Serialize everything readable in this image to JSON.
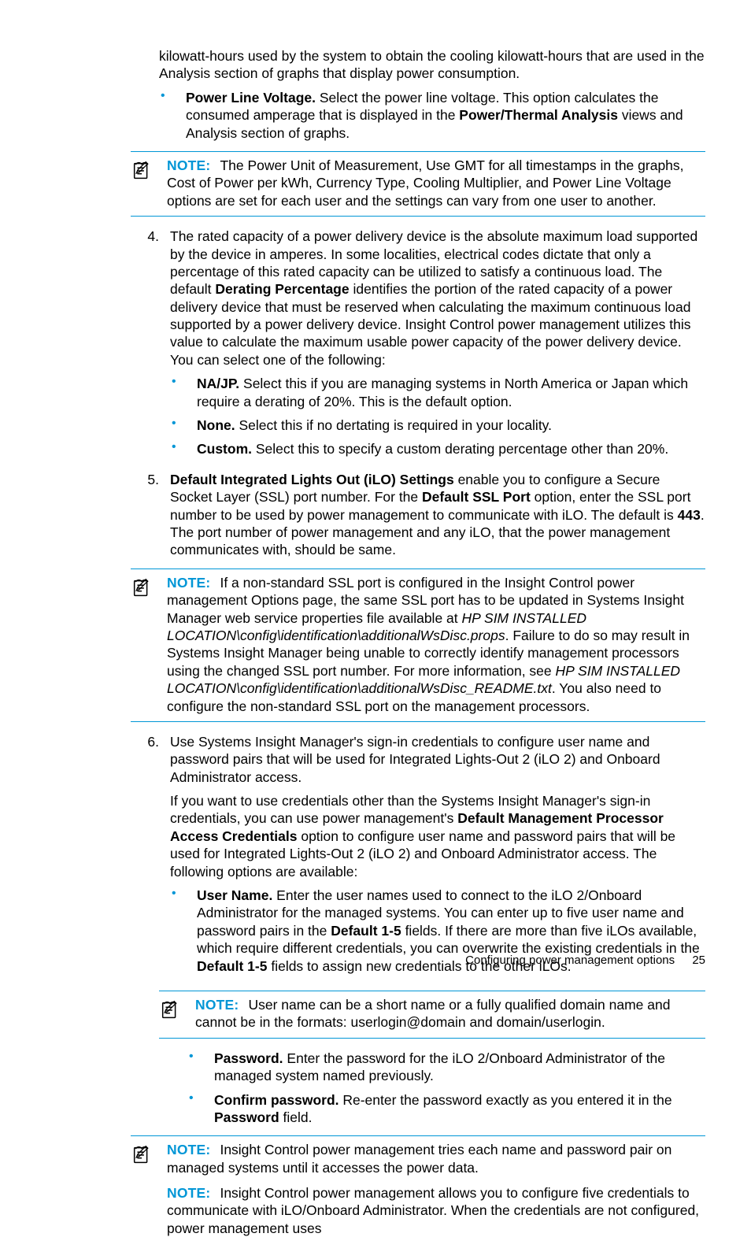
{
  "intro": {
    "p1": "kilowatt-hours used by the system to obtain the cooling kilowatt-hours that are used in the Analysis section of graphs that display power consumption."
  },
  "pvolt": {
    "label": "Power Line Voltage.",
    "text_a": " Select the power line voltage. This option calculates the consumed amperage that is displayed in the ",
    "b1": "Power/Thermal Analysis",
    "text_b": " views and Analysis section of graphs."
  },
  "note1": {
    "label": "NOTE:",
    "text": "The Power Unit of Measurement, Use GMT for all timestamps in the graphs, Cost of Power per kWh, Currency Type, Cooling Multiplier, and Power Line Voltage options are set for each user and the settings can vary from one user to another."
  },
  "item4": {
    "num": "4.",
    "text_a": "The rated capacity of a power delivery device is the absolute maximum load supported by the device in amperes. In some localities, electrical codes dictate that only a percentage of this rated capacity can be utilized to satisfy a continuous load. The default ",
    "b1": "Derating Percentage",
    "text_b": " identifies the portion of the rated capacity of a power delivery device that must be reserved when calculating the maximum continuous load supported by a power delivery device. Insight Control power management utilizes this value to calculate the maximum usable power capacity of the power delivery device. You can select one of the following:",
    "li1_label": "NA/JP.",
    "li1_text": " Select this if you are managing systems in North America or Japan which require a derating of 20%. This is the default option.",
    "li2_label": "None.",
    "li2_text": " Select this if no dertating is required in your locality.",
    "li3_label": "Custom.",
    "li3_text": " Select this to specify a custom derating percentage other than 20%."
  },
  "item5": {
    "num": "5.",
    "b1": "Default Integrated Lights Out (iLO) Settings",
    "text_a": " enable you to configure a Secure Socket Layer (SSL) port number. For the ",
    "b2": "Default SSL Port",
    "text_b": " option, enter the SSL port number to be used by power management to communicate with iLO. The default is ",
    "b3": "443",
    "text_c": ". The port number of power management and any iLO, that the power management communicates with, should be same."
  },
  "note2": {
    "label": "NOTE:",
    "text_a": "If a non-standard SSL port is configured in the Insight Control power management Options page, the same SSL port has to be updated in Systems Insight Manager web service properties file available at ",
    "i1": "HP SIM INSTALLED LOCATION\\config\\identification\\additionalWsDisc.props",
    "text_b": ". Failure to do so may result in Systems Insight Manager being unable to correctly identify management processors using the changed SSL port number. For more information, see ",
    "i2": "HP SIM INSTALLED LOCATION\\config\\identification\\additionalWsDisc_README.txt",
    "text_c": ". You also need to configure the non-standard SSL port on the management processors."
  },
  "item6": {
    "num": "6.",
    "p1": "Use Systems Insight Manager's sign-in credentials to configure user name and password pairs that will be used for Integrated Lights-Out 2 (iLO 2) and Onboard Administrator access.",
    "p2a": "If you want to use credentials other than the Systems Insight Manager's sign-in credentials, you can use power management's ",
    "b1": "Default Management Processor Access Credentials",
    "p2b": " option to configure user name and password pairs that will be used for Integrated Lights-Out 2 (iLO 2) and Onboard Administrator access. The following options are available:",
    "li1_label": "User Name.",
    "li1_a": " Enter the user names used to connect to the iLO 2/Onboard Administrator for the managed systems. You can enter up to five user name and password pairs in the ",
    "li1_b1": "Default 1-5",
    "li1_b": " fields. If there are more than five iLOs available, which require different credentials, you can overwrite the existing credentials in the ",
    "li1_b2": "Default 1-5",
    "li1_c": " fields to assign new credentials to the other iLOs."
  },
  "note3": {
    "label": "NOTE:",
    "text": "User name can be a short name or a fully qualified domain name and cannot be in the formats: userlogin@domain and domain/userlogin."
  },
  "item6b": {
    "li2_label": "Password.",
    "li2_text": " Enter the password for the iLO 2/Onboard Administrator of the managed system named previously.",
    "li3_label": "Confirm password.",
    "li3_a": " Re-enter the password exactly as you entered it in the ",
    "li3_b1": "Password",
    "li3_b": " field."
  },
  "note4": {
    "label": "NOTE:",
    "text1": "Insight Control power management tries each name and password pair on managed systems until it accesses the power data.",
    "label2": "NOTE:",
    "text2": "Insight Control power management allows you to configure five credentials to communicate with iLO/Onboard Administrator. When the credentials are not configured, power management uses"
  },
  "footer": {
    "section": "Configuring power management options",
    "page": "25"
  }
}
